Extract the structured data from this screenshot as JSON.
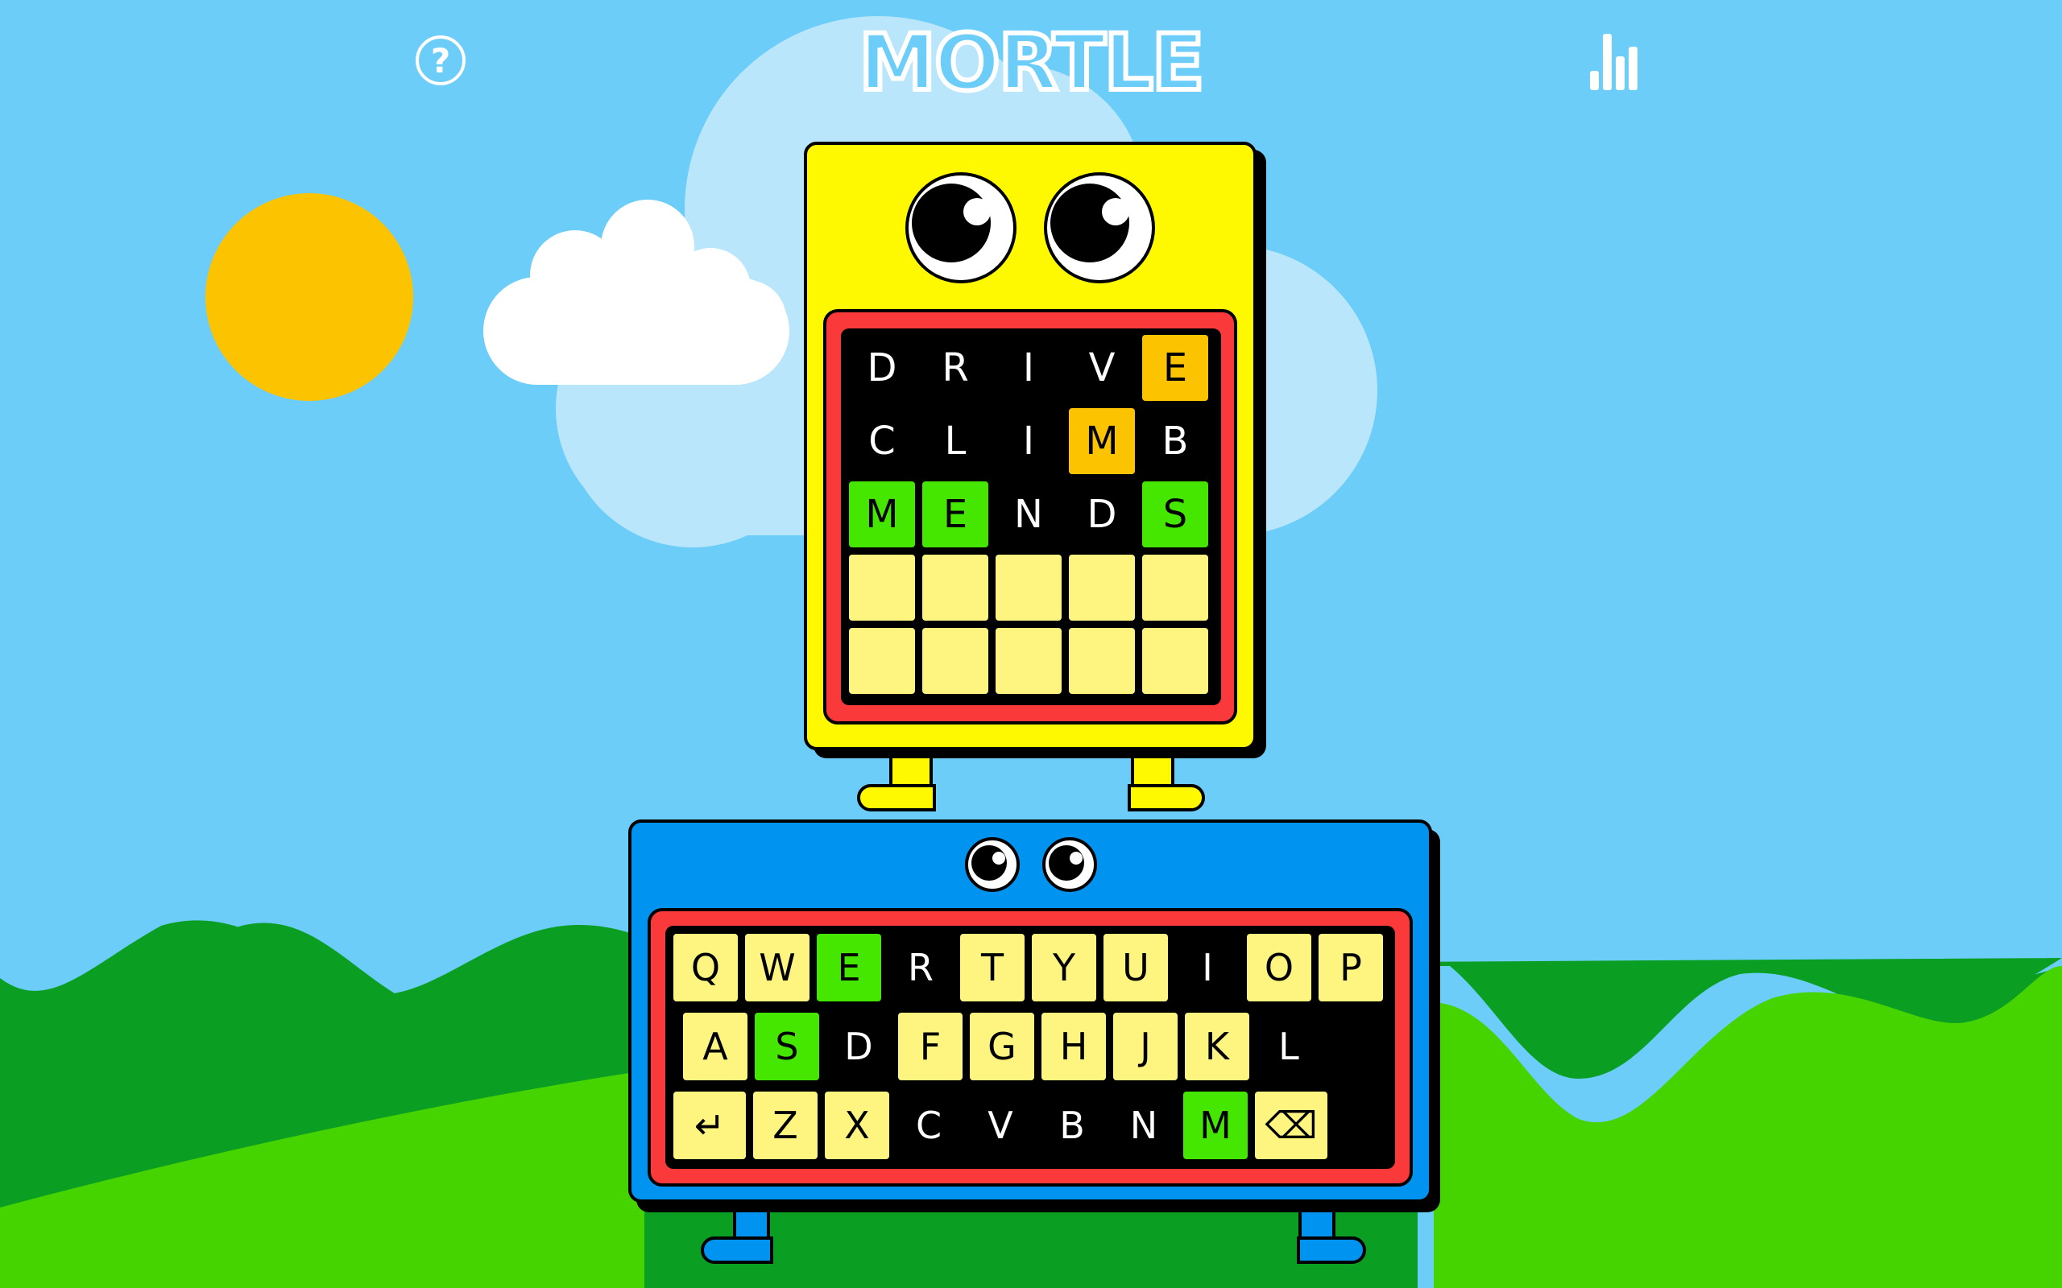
{
  "header": {
    "help_icon": "question-circle-icon",
    "logo_text": "MORTLE",
    "stats_icon": "bar-chart-icon"
  },
  "colors": {
    "sky": "#6ccdf8",
    "sun": "#fcc300",
    "board": "#fef900",
    "keyboard_body": "#0094f0",
    "frame_red": "#f9393a",
    "tile_empty": "#fdf57f",
    "tile_present": "#fcc300",
    "tile_correct": "#45e600",
    "hill_dark": "#0a9e23",
    "hill_light": "#45d400"
  },
  "grid": {
    "rows": [
      [
        {
          "letter": "D",
          "state": "absent"
        },
        {
          "letter": "R",
          "state": "absent"
        },
        {
          "letter": "I",
          "state": "absent"
        },
        {
          "letter": "V",
          "state": "absent"
        },
        {
          "letter": "E",
          "state": "present"
        }
      ],
      [
        {
          "letter": "C",
          "state": "absent"
        },
        {
          "letter": "L",
          "state": "absent"
        },
        {
          "letter": "I",
          "state": "absent"
        },
        {
          "letter": "M",
          "state": "present"
        },
        {
          "letter": "B",
          "state": "absent"
        }
      ],
      [
        {
          "letter": "M",
          "state": "correct"
        },
        {
          "letter": "E",
          "state": "correct"
        },
        {
          "letter": "N",
          "state": "absent"
        },
        {
          "letter": "D",
          "state": "absent"
        },
        {
          "letter": "S",
          "state": "correct"
        }
      ],
      [
        {
          "letter": "",
          "state": "empty"
        },
        {
          "letter": "",
          "state": "empty"
        },
        {
          "letter": "",
          "state": "empty"
        },
        {
          "letter": "",
          "state": "empty"
        },
        {
          "letter": "",
          "state": "empty"
        }
      ],
      [
        {
          "letter": "",
          "state": "empty"
        },
        {
          "letter": "",
          "state": "empty"
        },
        {
          "letter": "",
          "state": "empty"
        },
        {
          "letter": "",
          "state": "empty"
        },
        {
          "letter": "",
          "state": "empty"
        }
      ]
    ]
  },
  "keyboard": {
    "row1": [
      {
        "label": "Q",
        "state": "unused"
      },
      {
        "label": "W",
        "state": "unused"
      },
      {
        "label": "E",
        "state": "correct"
      },
      {
        "label": "R",
        "state": "absent"
      },
      {
        "label": "T",
        "state": "unused"
      },
      {
        "label": "Y",
        "state": "unused"
      },
      {
        "label": "U",
        "state": "unused"
      },
      {
        "label": "I",
        "state": "absent"
      },
      {
        "label": "O",
        "state": "unused"
      },
      {
        "label": "P",
        "state": "unused"
      }
    ],
    "row2": [
      {
        "label": "A",
        "state": "unused"
      },
      {
        "label": "S",
        "state": "correct"
      },
      {
        "label": "D",
        "state": "absent"
      },
      {
        "label": "F",
        "state": "unused"
      },
      {
        "label": "G",
        "state": "unused"
      },
      {
        "label": "H",
        "state": "unused"
      },
      {
        "label": "J",
        "state": "unused"
      },
      {
        "label": "K",
        "state": "unused"
      },
      {
        "label": "L",
        "state": "absent"
      }
    ],
    "row3": [
      {
        "label": "↵",
        "state": "unused",
        "name": "enter-key",
        "icon": "enter-icon"
      },
      {
        "label": "Z",
        "state": "unused"
      },
      {
        "label": "X",
        "state": "unused"
      },
      {
        "label": "C",
        "state": "absent"
      },
      {
        "label": "V",
        "state": "absent"
      },
      {
        "label": "B",
        "state": "absent"
      },
      {
        "label": "N",
        "state": "absent"
      },
      {
        "label": "M",
        "state": "correct"
      },
      {
        "label": "⌫",
        "state": "unused",
        "name": "backspace-key",
        "icon": "backspace-icon"
      }
    ]
  }
}
